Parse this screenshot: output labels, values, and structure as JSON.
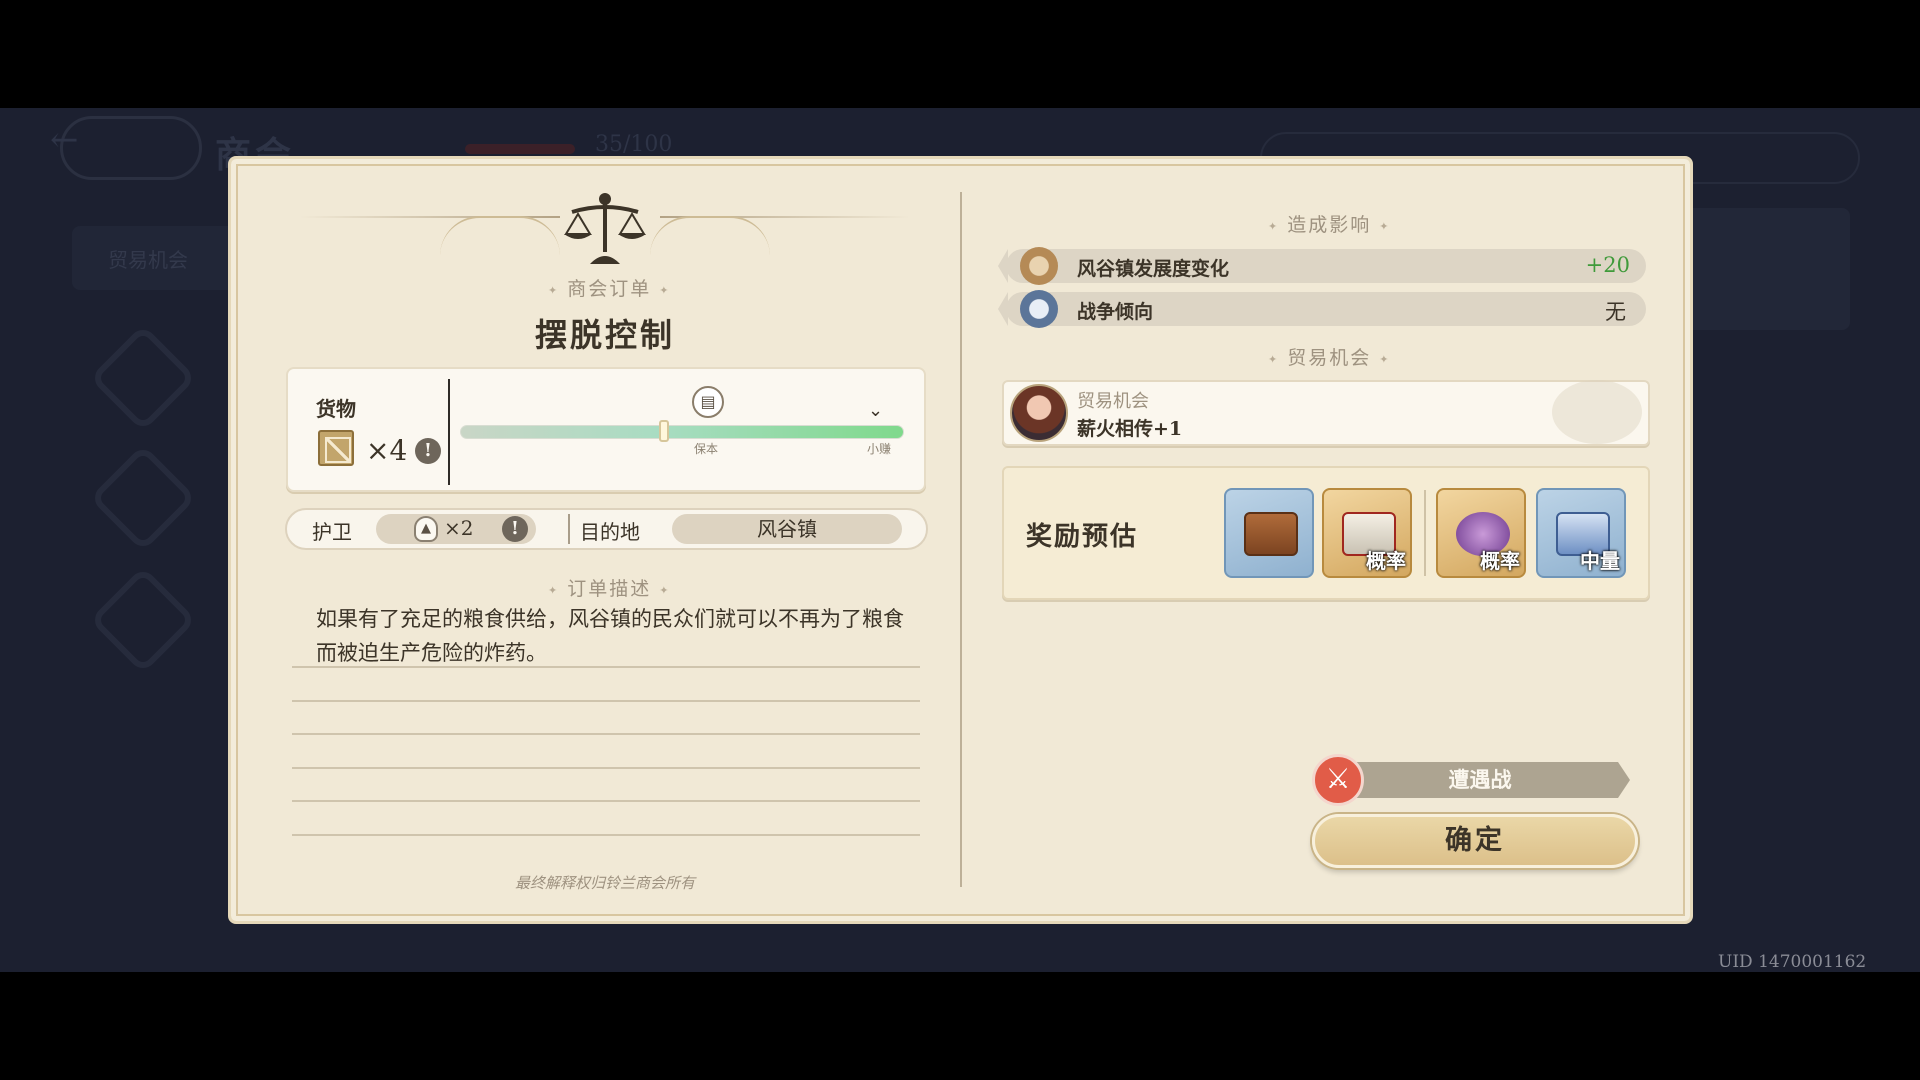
{
  "background": {
    "title": "商会",
    "tab": "贸易机会",
    "progress_text": "35/100"
  },
  "uid": "UID 1470001162",
  "order": {
    "section_label": "商会订单",
    "title": "摆脱控制",
    "cargo": {
      "label": "货物",
      "count": "×4",
      "icon": "crate-icon",
      "info": "!"
    },
    "slider": {
      "value": 0.46,
      "left_caption": "保本",
      "right_caption": "小赚",
      "pin_icon": "merchant-icon"
    },
    "guard": {
      "label": "护卫",
      "count": "×2",
      "icon": "helmet-icon",
      "info": "!"
    },
    "destination": {
      "label": "目的地",
      "value": "风谷镇"
    },
    "description_label": "订单描述",
    "description": "如果有了充足的粮食供给，风谷镇的民众们就可以不再为了粮食而被迫生产危险的炸药。",
    "footnote": "最终解释权归铃兰商会所有"
  },
  "impact": {
    "section_label": "造成影响",
    "rows": [
      {
        "label": "风谷镇发展度变化",
        "value": "+20",
        "value_color": "#3f9a3a",
        "icon": "town-emblem-icon"
      },
      {
        "label": "战争倾向",
        "value": "无",
        "value_color": "#3c3428",
        "icon": "war-tendency-icon"
      }
    ]
  },
  "trade": {
    "section_label": "贸易机会",
    "top_label": "贸易机会",
    "main_label": "薪火相传+1",
    "icon": "character-portrait"
  },
  "rewards": {
    "label": "奖励预估",
    "items": [
      {
        "name": "wooden-crate",
        "tag": ""
      },
      {
        "name": "gift-box",
        "tag": "概率"
      },
      {
        "name": "potion-jar",
        "tag": "概率"
      },
      {
        "name": "blue-chest",
        "tag": "中量"
      }
    ]
  },
  "encounter": {
    "label": "遭遇战",
    "icon": "crossed-swords-icon"
  },
  "confirm_label": "确定"
}
